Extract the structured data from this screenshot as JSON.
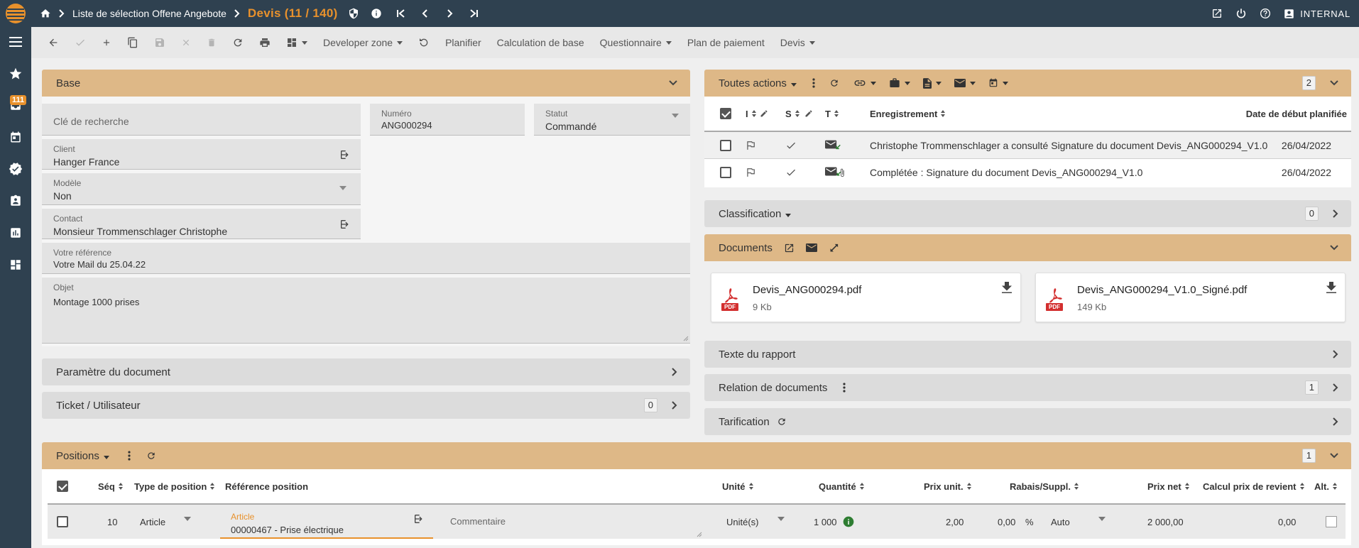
{
  "topbar": {
    "breadcrumb": "Liste de sélection Offene Angebote",
    "title": "Devis (11 / 140)",
    "user": "INTERNAL"
  },
  "sidebar": {
    "badge": "111"
  },
  "toolbar": {
    "developer_zone": "Developer zone",
    "planifier": "Planifier",
    "calculation": "Calculation de base",
    "questionnaire": "Questionnaire",
    "plan_paiement": "Plan de paiement",
    "devis": "Devis"
  },
  "base": {
    "title": "Base",
    "search_key_placeholder": "Clé de recherche",
    "numero_label": "Numéro",
    "numero_value": "ANG000294",
    "statut_label": "Statut",
    "statut_value": "Commandé",
    "client_label": "Client",
    "client_value": "Hanger France",
    "modele_label": "Modèle",
    "modele_value": "Non",
    "contact_label": "Contact",
    "contact_value": "Monsieur Trommenschlager Christophe",
    "reference_label": "Votre référence",
    "reference_value": "Votre Mail du 25.04.22",
    "objet_label": "Objet",
    "objet_value": "Montage 1000 prises"
  },
  "param_doc": {
    "title": "Paramètre du document"
  },
  "ticket": {
    "title": "Ticket / Utilisateur",
    "count": "0"
  },
  "actions": {
    "title": "Toutes actions",
    "count": "2",
    "columns": {
      "i": "I",
      "s": "S",
      "t": "T",
      "record": "Enregistrement",
      "date": "Date de début planifiée"
    },
    "rows": [
      {
        "record": "Christophe Trommenschlager a consulté Signature du document Devis_ANG000294_V1.0",
        "date": "26/04/2022"
      },
      {
        "record": "Complétée : Signature du document Devis_ANG000294_V1.0",
        "date": "26/04/2022"
      }
    ]
  },
  "classification": {
    "title": "Classification",
    "count": "0"
  },
  "documents": {
    "title": "Documents",
    "pdf_tag": "PDF",
    "files": [
      {
        "name": "Devis_ANG000294.pdf",
        "size": "9 Kb"
      },
      {
        "name": "Devis_ANG000294_V1.0_Signé.pdf",
        "size": "149 Kb"
      }
    ]
  },
  "texte_rapport": {
    "title": "Texte du rapport"
  },
  "relation_docs": {
    "title": "Relation de documents",
    "count": "1"
  },
  "tarification": {
    "title": "Tarification"
  },
  "positions": {
    "title": "Positions",
    "count": "1",
    "columns": {
      "seq": "Séq",
      "type": "Type de position",
      "ref": "Référence position",
      "unite": "Unité",
      "quantite": "Quantité",
      "prix_unit": "Prix unit.",
      "rabais": "Rabais/Suppl.",
      "prix_net": "Prix net",
      "calcul": "Calcul prix de revient",
      "alt": "Alt."
    },
    "row": {
      "seq": "10",
      "type": "Article",
      "ref_label": "Article",
      "ref_value": "00000467 - Prise électrique",
      "comment_placeholder": "Commentaire",
      "unite": "Unité(s)",
      "quantite": "1 000",
      "prix_unit": "2,00",
      "rabais": "0,00",
      "rabais_unit": "%",
      "rabais_mode": "Auto",
      "prix_net": "2 000,00",
      "calcul": "0,00"
    }
  },
  "colors": {
    "topbar": "#2f4150",
    "accent": "#e8912c",
    "panel": "#deb887"
  }
}
